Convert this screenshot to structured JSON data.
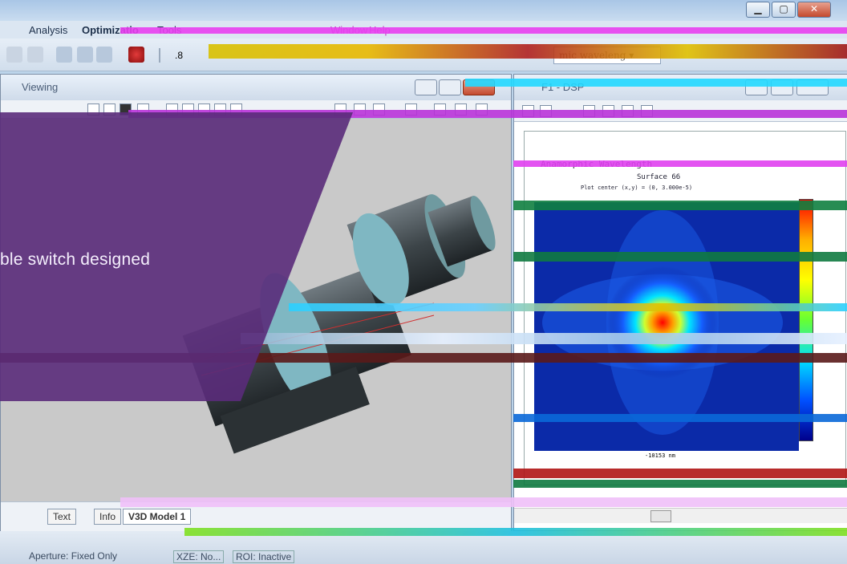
{
  "window": {
    "min_glyph": "▁",
    "max_glyph": "▢",
    "close_glyph": "✕"
  },
  "menu": {
    "items": [
      "Analysis",
      "Optimizatio",
      "Tools",
      "Window",
      "Help"
    ]
  },
  "toolbar": {
    "combo_text": "mic waveleng ▾",
    "zoom_text": ".8"
  },
  "left_window": {
    "title": "Viewing",
    "tabs": [
      "Text",
      "Info",
      "V3D Model 1"
    ]
  },
  "right_window": {
    "title": "F1 - DSP",
    "plot_title": "Anamorphic Wavelength",
    "plot_subtitle": "Surface 66",
    "plot_center": "Plot center (x,y) = (0, 3.000e-5)",
    "axis_note": "-10153 nm"
  },
  "status": {
    "left": "Aperture: Fixed Only",
    "middle": "XZE: No...",
    "right": "ROI: Inactive"
  },
  "overlay": {
    "text": "ble switch designed"
  },
  "colors": {
    "accent_purple": "#5a2b7a",
    "window_blue": "#bcd4ea"
  }
}
